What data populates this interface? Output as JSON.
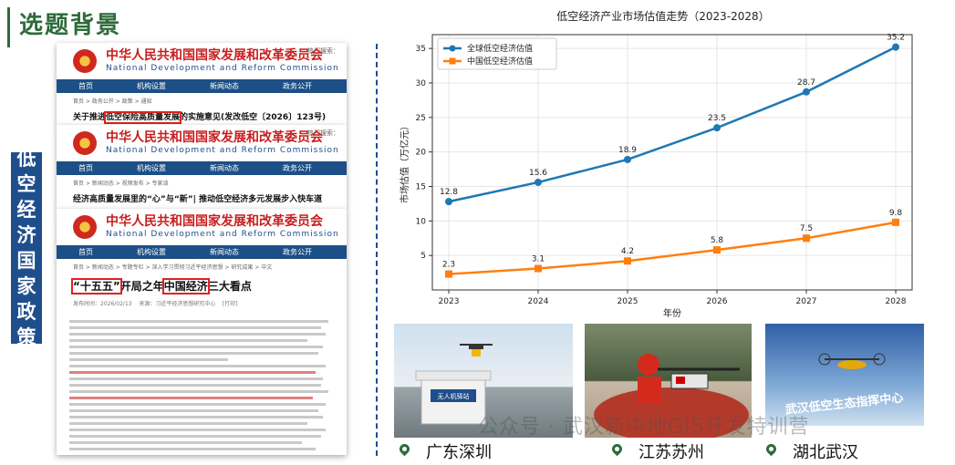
{
  "slide": {
    "title": "选题背景",
    "side_label_chars": [
      "低",
      "空",
      "经",
      "济",
      "国",
      "家",
      "政",
      "策"
    ]
  },
  "docs": [
    {
      "org_cn": "中华人民共和国国家发展和改革委员会",
      "org_en": "National Development and Reform Commission",
      "topright": "热门搜索：",
      "nav": [
        "首页",
        "机构设置",
        "新闻动态",
        "政务公开"
      ],
      "crumb": "首页 > 政务公开 > 政策 > 通知",
      "headline_pre": "关于推进",
      "headline_hl": "低空保险高质量发展",
      "headline_post": "的实施意见(发改低空〔2026〕123号)"
    },
    {
      "org_cn": "中华人民共和国国家发展和改革委员会",
      "org_en": "National Development and Reform Commission",
      "topright": "热门搜索：",
      "nav": [
        "首页",
        "机构设置",
        "新闻动态",
        "政务公开"
      ],
      "crumb": "首页 > 新闻动态 > 视频发布 > 专家谈",
      "headline": "经济高质量发展里的“心”与“新”| 推动低空经济多元发展步入快车道"
    },
    {
      "org_cn": "中华人民共和国国家发展和改革委员会",
      "org_en": "National Development and Reform Commission",
      "nav": [
        "首页",
        "机构设置",
        "新闻动态",
        "政务公开"
      ],
      "crumb": "首页 > 新闻动态 > 专题专栏 > 深入学习贯彻习近平经济思想 > 研究成果 > 中文",
      "headline_hl1": "“十五五”",
      "headline_mid": "开局之年",
      "headline_hl2": "中国经济",
      "headline_post": "三大看点",
      "meta_date": "发布时间：2026/02/13",
      "meta_source": "来源：习近平经济思想研究中心",
      "meta_print": "[打印]"
    }
  ],
  "chart_data": {
    "type": "line",
    "title": "低空经济产业市场估值走势（2023-2028）",
    "xlabel": "年份",
    "ylabel": "市场估值（万亿元）",
    "x": [
      2023,
      2024,
      2025,
      2026,
      2027,
      2028
    ],
    "ylim": [
      0,
      37
    ],
    "yticks": [
      5,
      10,
      15,
      20,
      25,
      30,
      35
    ],
    "grid": true,
    "legend": "top-left",
    "series": [
      {
        "name": "全球低空经济估值",
        "color": "#1f77b4",
        "marker": "circle",
        "values": [
          12.8,
          15.6,
          18.9,
          23.5,
          28.7,
          35.2
        ]
      },
      {
        "name": "中国低空经济估值",
        "color": "#ff7f0e",
        "marker": "square",
        "values": [
          2.3,
          3.1,
          4.2,
          5.8,
          7.5,
          9.8
        ]
      }
    ]
  },
  "locations": [
    "广东深圳",
    "江苏苏州",
    "湖北武汉"
  ],
  "photo_texts": {
    "photo1": "无人机驿站",
    "photo3": "武汉低空生态指挥中心"
  },
  "watermark": "公众号 · 武汉新中地GIS开发特训营"
}
